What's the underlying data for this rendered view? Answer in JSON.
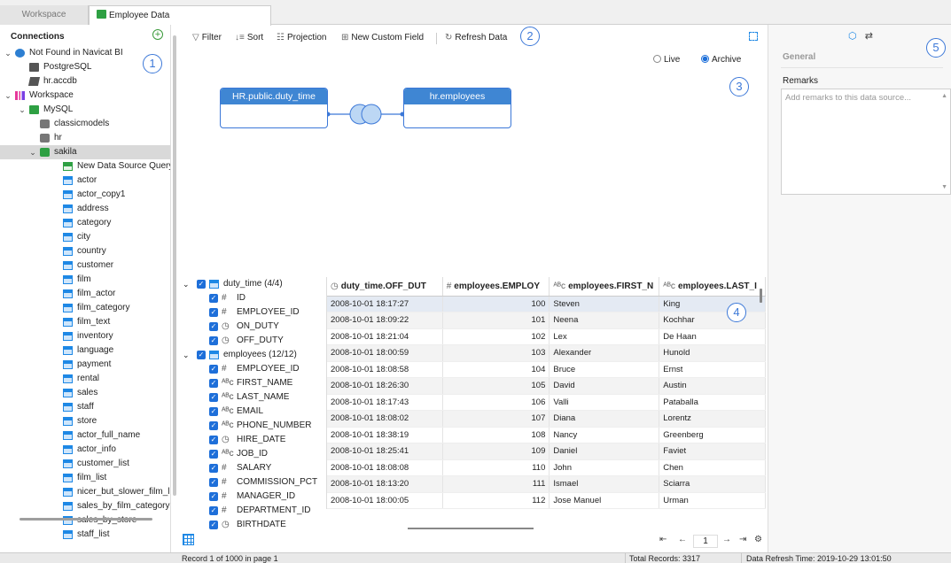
{
  "tabs": [
    {
      "label": "Workspace"
    },
    {
      "label": "Employee Data"
    }
  ],
  "sidebar": {
    "title": "Connections",
    "items": [
      {
        "label": "Not Found in Navicat BI",
        "level": 0,
        "expanded": true,
        "icon": "info-icon"
      },
      {
        "label": "PostgreSQL",
        "level": 1,
        "icon": "postgresql-icon"
      },
      {
        "label": "hr.accdb",
        "level": 1,
        "icon": "access-icon"
      },
      {
        "label": "Workspace",
        "level": 0,
        "expanded": true,
        "icon": "workspace-icon"
      },
      {
        "label": "MySQL",
        "level": 1,
        "expanded": true,
        "icon": "mysql-icon"
      },
      {
        "label": "classicmodels",
        "level": 2,
        "icon": "database-icon"
      },
      {
        "label": "hr",
        "level": 2,
        "icon": "database-icon"
      },
      {
        "label": "sakila",
        "level": 2,
        "expanded": true,
        "selected": true,
        "icon": "database-open-icon"
      },
      {
        "label": "New Data Source Query",
        "level": 3,
        "icon": "new-query-icon"
      },
      {
        "label": "actor",
        "level": 3,
        "icon": "table-icon"
      },
      {
        "label": "actor_copy1",
        "level": 3,
        "icon": "table-icon"
      },
      {
        "label": "address",
        "level": 3,
        "icon": "table-icon"
      },
      {
        "label": "category",
        "level": 3,
        "icon": "table-icon"
      },
      {
        "label": "city",
        "level": 3,
        "icon": "table-icon"
      },
      {
        "label": "country",
        "level": 3,
        "icon": "table-icon"
      },
      {
        "label": "customer",
        "level": 3,
        "icon": "table-icon"
      },
      {
        "label": "film",
        "level": 3,
        "icon": "table-icon"
      },
      {
        "label": "film_actor",
        "level": 3,
        "icon": "table-icon"
      },
      {
        "label": "film_category",
        "level": 3,
        "icon": "table-icon"
      },
      {
        "label": "film_text",
        "level": 3,
        "icon": "table-icon"
      },
      {
        "label": "inventory",
        "level": 3,
        "icon": "table-icon"
      },
      {
        "label": "language",
        "level": 3,
        "icon": "table-icon"
      },
      {
        "label": "payment",
        "level": 3,
        "icon": "table-icon"
      },
      {
        "label": "rental",
        "level": 3,
        "icon": "table-icon"
      },
      {
        "label": "sales",
        "level": 3,
        "icon": "table-icon"
      },
      {
        "label": "staff",
        "level": 3,
        "icon": "table-icon"
      },
      {
        "label": "store",
        "level": 3,
        "icon": "table-icon"
      },
      {
        "label": "actor_full_name",
        "level": 3,
        "icon": "view-icon"
      },
      {
        "label": "actor_info",
        "level": 3,
        "icon": "view-icon"
      },
      {
        "label": "customer_list",
        "level": 3,
        "icon": "view-icon"
      },
      {
        "label": "film_list",
        "level": 3,
        "icon": "view-icon"
      },
      {
        "label": "nicer_but_slower_film_li",
        "level": 3,
        "icon": "view-icon"
      },
      {
        "label": "sales_by_film_category",
        "level": 3,
        "icon": "view-icon"
      },
      {
        "label": "sales_by_store",
        "level": 3,
        "icon": "view-icon"
      },
      {
        "label": "staff_list",
        "level": 3,
        "icon": "view-icon"
      }
    ]
  },
  "callouts": [
    "1",
    "2",
    "3",
    "4",
    "5"
  ],
  "toolbar": {
    "filter": "Filter",
    "sort": "Sort",
    "projection": "Projection",
    "new_custom_field": "New Custom Field",
    "refresh": "Refresh Data"
  },
  "mode": {
    "live": "Live",
    "archive": "Archive",
    "selected": "archive"
  },
  "diagram": {
    "left_table": "HR.public.duty_time",
    "right_table": "hr.employees",
    "join_type": "inner-join-icon"
  },
  "right_panel": {
    "section": "General",
    "remarks_label": "Remarks",
    "remarks_placeholder": "Add remarks to this data source..."
  },
  "fields": {
    "groups": [
      {
        "label": "duty_time (4/4)",
        "fields": [
          {
            "name": "ID",
            "type": "#"
          },
          {
            "name": "EMPLOYEE_ID",
            "type": "#"
          },
          {
            "name": "ON_DUTY",
            "type": "◷"
          },
          {
            "name": "OFF_DUTY",
            "type": "◷"
          }
        ]
      },
      {
        "label": "employees (12/12)",
        "fields": [
          {
            "name": "EMPLOYEE_ID",
            "type": "#"
          },
          {
            "name": "FIRST_NAME",
            "type": "ᴬᴮc"
          },
          {
            "name": "LAST_NAME",
            "type": "ᴬᴮc"
          },
          {
            "name": "EMAIL",
            "type": "ᴬᴮc"
          },
          {
            "name": "PHONE_NUMBER",
            "type": "ᴬᴮc"
          },
          {
            "name": "HIRE_DATE",
            "type": "◷"
          },
          {
            "name": "JOB_ID",
            "type": "ᴬᴮc"
          },
          {
            "name": "SALARY",
            "type": "#"
          },
          {
            "name": "COMMISSION_PCT",
            "type": "#"
          },
          {
            "name": "MANAGER_ID",
            "type": "#"
          },
          {
            "name": "DEPARTMENT_ID",
            "type": "#"
          },
          {
            "name": "BIRTHDATE",
            "type": "◷"
          }
        ]
      }
    ]
  },
  "grid": {
    "columns": [
      {
        "label": "duty_time.OFF_DUT",
        "type": "◷"
      },
      {
        "label": "employees.EMPLOY",
        "type": "#"
      },
      {
        "label": "employees.FIRST_N",
        "type": "ᴬᴮc"
      },
      {
        "label": "employees.LAST_I",
        "type": "ᴬᴮc"
      }
    ],
    "rows": [
      [
        "2008-10-01 18:17:27",
        "100",
        "Steven",
        "King"
      ],
      [
        "2008-10-01 18:09:22",
        "101",
        "Neena",
        "Kochhar"
      ],
      [
        "2008-10-01 18:21:04",
        "102",
        "Lex",
        "De Haan"
      ],
      [
        "2008-10-01 18:00:59",
        "103",
        "Alexander",
        "Hunold"
      ],
      [
        "2008-10-01 18:08:58",
        "104",
        "Bruce",
        "Ernst"
      ],
      [
        "2008-10-01 18:26:30",
        "105",
        "David",
        "Austin"
      ],
      [
        "2008-10-01 18:17:43",
        "106",
        "Valli",
        "Pataballa"
      ],
      [
        "2008-10-01 18:08:02",
        "107",
        "Diana",
        "Lorentz"
      ],
      [
        "2008-10-01 18:38:19",
        "108",
        "Nancy",
        "Greenberg"
      ],
      [
        "2008-10-01 18:25:41",
        "109",
        "Daniel",
        "Faviet"
      ],
      [
        "2008-10-01 18:08:08",
        "110",
        "John",
        "Chen"
      ],
      [
        "2008-10-01 18:13:20",
        "111",
        "Ismael",
        "Sciarra"
      ],
      [
        "2008-10-01 18:00:05",
        "112",
        "Jose Manuel",
        "Urman"
      ]
    ],
    "page": "1"
  },
  "status": {
    "record": "Record 1 of 1000 in page 1",
    "total": "Total Records: 3317",
    "refresh_time": "Data Refresh Time: 2019-10-29 13:01:50"
  },
  "colors": {
    "accent": "#3c78d8",
    "node_header": "#3f86d3",
    "checkbox": "#1e6fd9",
    "selected_row": "#d9d9d9"
  }
}
